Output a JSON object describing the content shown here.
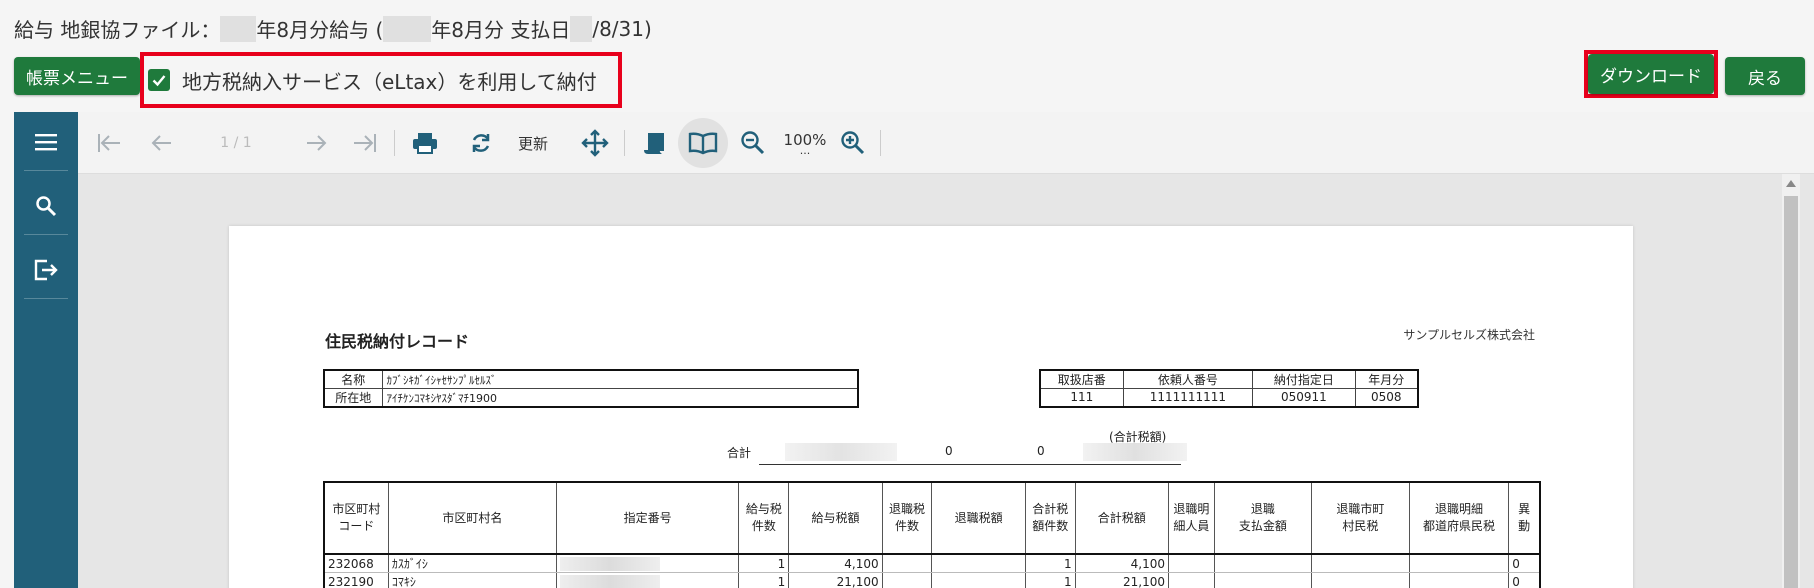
{
  "header": {
    "title_prefix": "給与 地銀協ファイル：",
    "title_mid1": "年8月分給与 (",
    "title_mid2": "年8月分 支払日",
    "title_suffix": "/8/31)"
  },
  "buttons": {
    "report_menu": "帳票メニュー",
    "eltax_label": "地方税納入サービス（eLtax）を利用して納付",
    "eltax_checked": true,
    "download": "ダウンロード",
    "back": "戻る"
  },
  "toolbar": {
    "page_indicator": "1 / 1",
    "refresh": "更新",
    "zoom": "100%",
    "zoom_more": "..."
  },
  "report": {
    "title": "住民税納付レコード",
    "company": "サンプルセルズ株式会社",
    "info_labels": {
      "name": "名称",
      "address": "所在地"
    },
    "info_values": {
      "name": "ｶﾌﾞｼｷｶﾞｲｼｬｾｻﾝﾌﾟﾙｾﾙｽﾞ",
      "address": "ｱｲﾁｹﾝｺﾏｷｼﾔｽﾀﾞﾏﾁ1900"
    },
    "meta_headers": [
      "取扱店番",
      "依頼人番号",
      "納付指定日",
      "年月分"
    ],
    "meta_values": [
      "111",
      "1111111111",
      "050911",
      "0508"
    ],
    "total": {
      "label": "合計",
      "v1": "0",
      "v2": "0",
      "note": "(合計税額)"
    },
    "columns": [
      "市区町村\nコード",
      "市区町村名",
      "指定番号",
      "給与税\n件数",
      "給与税額",
      "退職税\n件数",
      "退職税額",
      "合計税\n額件数",
      "合計税額",
      "退職明\n細人員",
      "退職\n支払金額",
      "退職市町\n村民税",
      "退職明細\n都道府県民税",
      "異\n動"
    ],
    "rows": [
      {
        "code": "232068",
        "name": "ｶｽｶﾞｲｼ",
        "salary_count": "1",
        "salary_tax": "4,100",
        "total_count": "1",
        "total_tax": "4,100",
        "change": "0"
      },
      {
        "code": "232190",
        "name": "ｺﾏｷｼ",
        "salary_count": "1",
        "salary_tax": "21,100",
        "total_count": "1",
        "total_tax": "21,100",
        "change": "0"
      }
    ]
  },
  "colors": {
    "primary_green": "#1f7a3c",
    "highlight_red": "#e8001c",
    "sidebar_teal": "#21607a"
  },
  "icons": [
    "menu-icon",
    "search-icon",
    "export-icon",
    "first-page-icon",
    "prev-page-icon",
    "next-page-icon",
    "last-page-icon",
    "print-icon",
    "refresh-icon",
    "pan-icon",
    "single-page-icon",
    "book-icon",
    "zoom-out-icon",
    "zoom-in-icon"
  ]
}
